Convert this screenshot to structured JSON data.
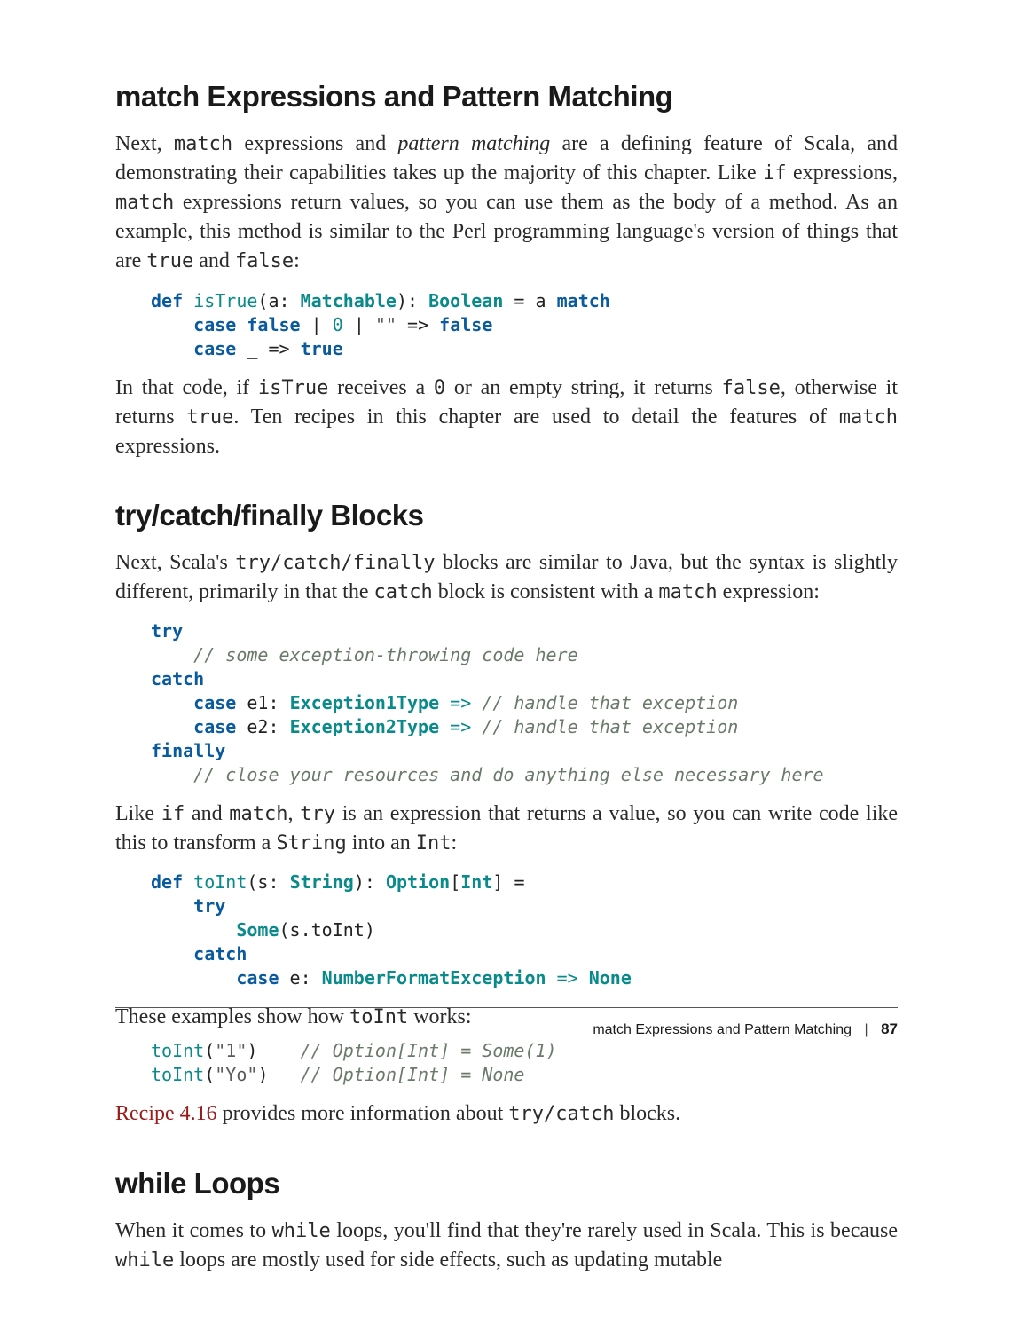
{
  "sections": {
    "s1": {
      "heading": "match Expressions and Pattern Matching",
      "p1_parts": {
        "a": "Next, ",
        "code_match": "match",
        "b": " expressions and ",
        "em": "pattern matching",
        "c": " are a defining feature of Scala, and demonstrating their capabilities takes up the majority of this chapter. Like ",
        "code_if": "if",
        "d": " expressions, ",
        "code_match2": "match",
        "e": " expressions return values, so you can use them as the body of a method. As an example, this method is similar to the Perl programming language's version of things that are ",
        "code_true": "true",
        "f": " and ",
        "code_false": "false",
        "g": ":"
      },
      "p2_parts": {
        "a": "In that code, if ",
        "code_isTrue": "isTrue",
        "b": " receives a ",
        "code_0": "0",
        "c": " or an empty string, it returns ",
        "code_false": "false",
        "d": ", otherwise it returns ",
        "code_true": "true",
        "e": ". Ten recipes in this chapter are used to detail the features of ",
        "code_match": "match",
        "f": " expressions."
      }
    },
    "s2": {
      "heading": "try/catch/finally Blocks",
      "p1_parts": {
        "a": "Next, Scala's ",
        "code_tcf": "try/catch/finally",
        "b": " blocks are similar to Java, but the syntax is slightly different, primarily in that the ",
        "code_catch": "catch",
        "c": " block is consistent with a ",
        "code_match": "match",
        "d": " expression:"
      },
      "p2_parts": {
        "a": "Like ",
        "code_if": "if",
        "b": " and ",
        "code_match": "match",
        "c": ", ",
        "code_try": "try",
        "d": " is an expression that returns a value, so you can write code like this to transform a ",
        "code_string": "String",
        "e": " into an ",
        "code_int": "Int",
        "f": ":"
      },
      "p3_parts": {
        "a": "These examples show how ",
        "code_toInt": "toInt",
        "b": " works:"
      },
      "p4_parts": {
        "link": "Recipe 4.16",
        "a": " provides more information about ",
        "code_tc": "try/catch",
        "b": " blocks."
      }
    },
    "s3": {
      "heading": "while Loops",
      "p1_parts": {
        "a": "When it comes to ",
        "code_while": "while",
        "b": " loops, you'll find that they're rarely used in Scala. This is because ",
        "code_while2": "while",
        "c": " loops are mostly used for side effects, such as updating mutable"
      }
    }
  },
  "code": {
    "block1": {
      "t": {
        "def": "def",
        "fn": "isTrue",
        "lparen": "(a: ",
        "ty1": "Matchable",
        "rparen": "): ",
        "ty2": "Boolean",
        "eq": " = a ",
        "match": "match",
        "line2a": "    ",
        "case1": "case",
        "line2b": " ",
        "false1": "false",
        "pipe": " | ",
        "zero": "0",
        "pipe2": " | ",
        "str": "\"\"",
        "arrow1": " => ",
        "false2": "false",
        "line3a": "    ",
        "case2": "case",
        "under": " _ ",
        "arrow2": "=> ",
        "true": "true"
      }
    },
    "block2": {
      "t": {
        "try": "try",
        "c1": "    // some exception-throwing code here",
        "catch": "catch",
        "l3a": "    ",
        "case1": "case",
        "l3b": " e1: ",
        "ty1": "Exception1Type",
        "arr1": " => ",
        "c2": "// handle that exception",
        "l4a": "    ",
        "case2": "case",
        "l4b": " e2: ",
        "ty2": "Exception2Type",
        "arr2": " => ",
        "c3": "// handle that exception",
        "finally": "finally",
        "c4": "    // close your resources and do anything else necessary here"
      }
    },
    "block3": {
      "t": {
        "def": "def",
        "sp1": " ",
        "fn": "toInt",
        "sig1": "(s: ",
        "ty1": "String",
        "sig2": "): ",
        "ty2": "Option",
        "br1": "[",
        "ty3": "Int",
        "br2": "] =",
        "l2a": "    ",
        "try": "try",
        "l3a": "        ",
        "some": "Some",
        "l3b": "(s.toInt)",
        "l4a": "    ",
        "catch": "catch",
        "l5a": "        ",
        "case": "case",
        "l5b": " e: ",
        "ty4": "NumberFormatException",
        "arr": " => ",
        "none": "None"
      }
    },
    "block4": {
      "t": {
        "fn1": "toInt",
        "a1": "(",
        "s1": "\"1\"",
        "a2": ")    ",
        "c1": "// Option[Int] = Some(1)",
        "fn2": "toInt",
        "b1": "(",
        "s2": "\"Yo\"",
        "b2": ")   ",
        "c2": "// Option[Int] = None"
      }
    }
  },
  "footer": {
    "title": "match Expressions and Pattern Matching",
    "sep": "|",
    "page": "87"
  }
}
